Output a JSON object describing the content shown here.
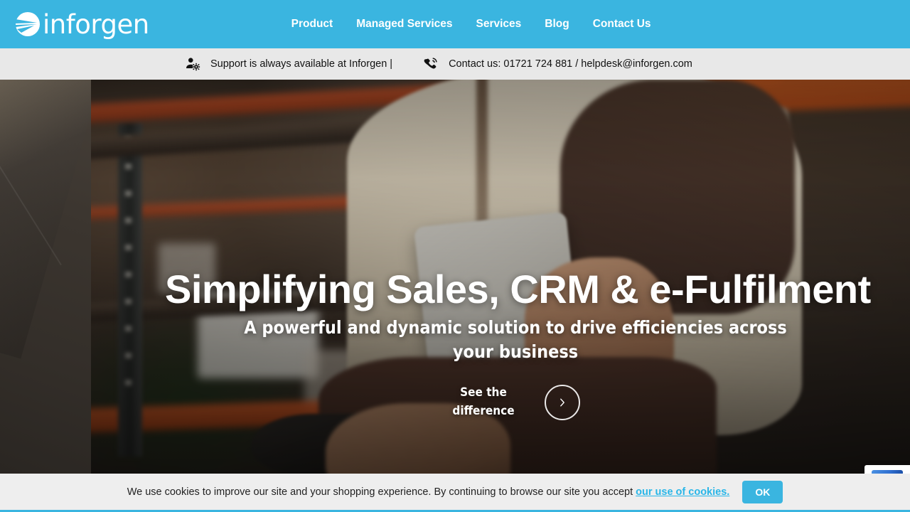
{
  "brand": {
    "name": "inforgen",
    "logo_icon": "inforgen-speedlines-circle-logo",
    "header_color": "#3ab5e0",
    "accent_color": "#29b6e8"
  },
  "nav": {
    "items": [
      {
        "label": "Product"
      },
      {
        "label": "Managed Services"
      },
      {
        "label": "Services"
      },
      {
        "label": "Blog"
      },
      {
        "label": "Contact Us"
      }
    ]
  },
  "support_bar": {
    "support_icon": "person-gear-icon",
    "support_text": "Support is always available at Inforgen |",
    "phone_icon": "phone-in-talk-icon",
    "contact_text": "Contact us: 01721 724 881 / helpdesk@inforgen.com"
  },
  "hero": {
    "title": "Simplifying Sales, CRM & e-Fulfilment",
    "subtitle": "A powerful and dynamic solution to drive efficiencies across your business",
    "cta_label": "See the difference",
    "cta_icon": "chevron-right-icon"
  },
  "cookie_banner": {
    "text_before": "We use cookies to improve our site and your shopping experience. By continuing to browse our site you accept ",
    "link_label": "our use of cookies.",
    "ok_label": "OK"
  }
}
